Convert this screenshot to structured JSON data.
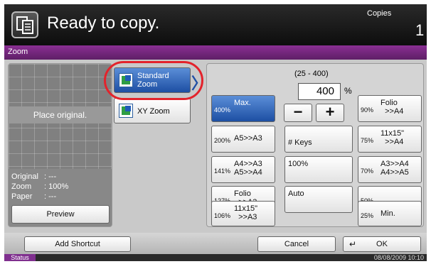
{
  "header": {
    "title": "Ready to copy.",
    "copies_label": "Copies",
    "copies_count": "1"
  },
  "tab": {
    "label": "Zoom"
  },
  "preview": {
    "place_original": "Place original.",
    "original_label": "Original",
    "original_value": ": ---",
    "zoom_label": "Zoom",
    "zoom_value": ": 100%",
    "paper_label": "Paper",
    "paper_value": ": ---",
    "preview_button": "Preview"
  },
  "modes": [
    {
      "label": "Standard\nZoom",
      "selected": true,
      "icon": "standard-zoom-icon"
    },
    {
      "label": "XY Zoom",
      "selected": false,
      "icon": "xy-zoom-icon"
    }
  ],
  "zoom": {
    "range": "(25 - 400)",
    "value": "400",
    "unit": "%",
    "keys_label": "# Keys",
    "hundred_label": "100%",
    "auto_label": "Auto",
    "presets_left": [
      {
        "pct": "400%",
        "label": "Max.",
        "selected": true
      },
      {
        "pct": "200%",
        "label": "A5>>A3"
      },
      {
        "pct": "141%",
        "label": "A4>>A3\nA5>>A4"
      },
      {
        "pct": "127%",
        "label": "Folio\n  >>A3"
      },
      {
        "pct": "106%",
        "label": "11x15\"\n  >>A3"
      }
    ],
    "presets_right": [
      {
        "pct": "90%",
        "label": "Folio\n  >>A4"
      },
      {
        "pct": "75%",
        "label": "11x15\"\n  >>A4"
      },
      {
        "pct": "70%",
        "label": "A3>>A4\nA4>>A5"
      },
      {
        "pct": "50%",
        "label": ""
      },
      {
        "pct": "25%",
        "label": "Min."
      }
    ]
  },
  "footer": {
    "add_shortcut": "Add Shortcut",
    "cancel": "Cancel",
    "ok": "OK"
  },
  "status": {
    "label": "Status",
    "datetime": "08/08/2009   10:10"
  },
  "colors": {
    "accent_purple": "#7f2f8e",
    "selected_blue": "#1d4fa3",
    "highlight_red": "#e3232b"
  }
}
